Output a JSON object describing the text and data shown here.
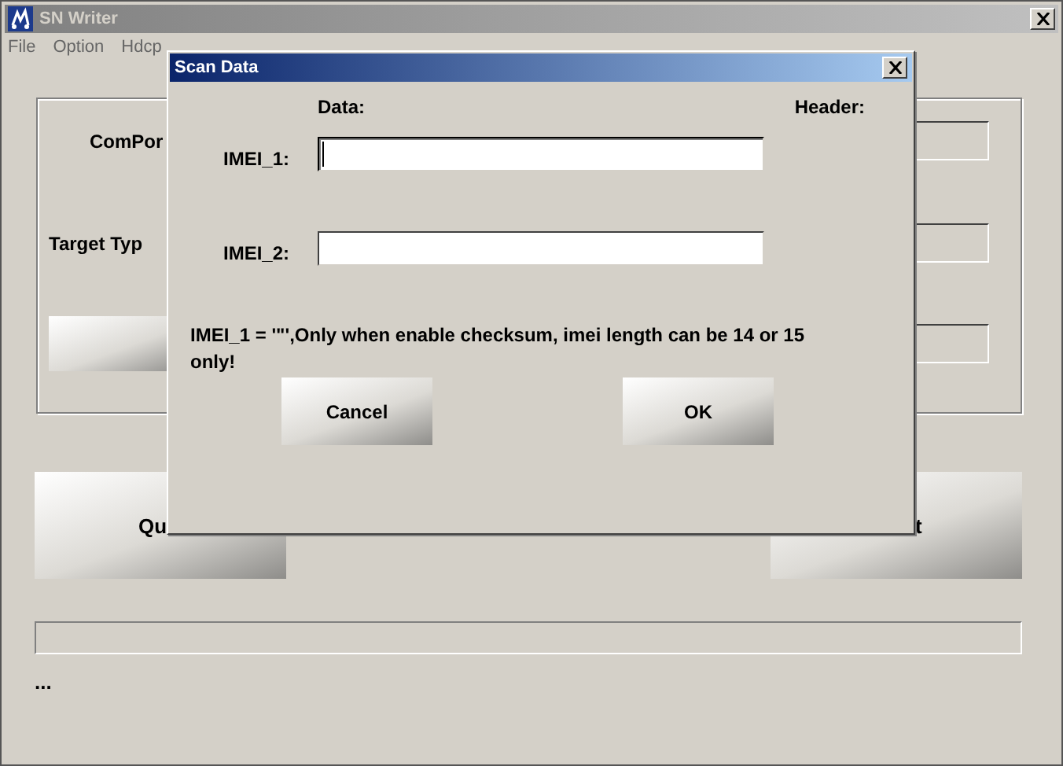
{
  "window": {
    "title": "SN Writer",
    "menu": [
      "File",
      "Option",
      "Hdcp"
    ]
  },
  "main": {
    "rows": [
      {
        "kind": "label",
        "label": "ComPor"
      },
      {
        "kind": "label",
        "label": "Target Typ"
      },
      {
        "kind": "button"
      }
    ],
    "buttons": [
      "Qu",
      "t"
    ],
    "status": "..."
  },
  "dialog": {
    "title": "Scan Data",
    "columns": [
      "Data:",
      "Header:"
    ],
    "fields": [
      {
        "label": "IMEI_1:",
        "focused": true
      },
      {
        "label": "IMEI_2:",
        "focused": false
      }
    ],
    "message": "IMEI_1 = '\"',Only when enable checksum, imei length can be 14 or 15 only!",
    "buttons": [
      "Cancel",
      "OK"
    ]
  }
}
